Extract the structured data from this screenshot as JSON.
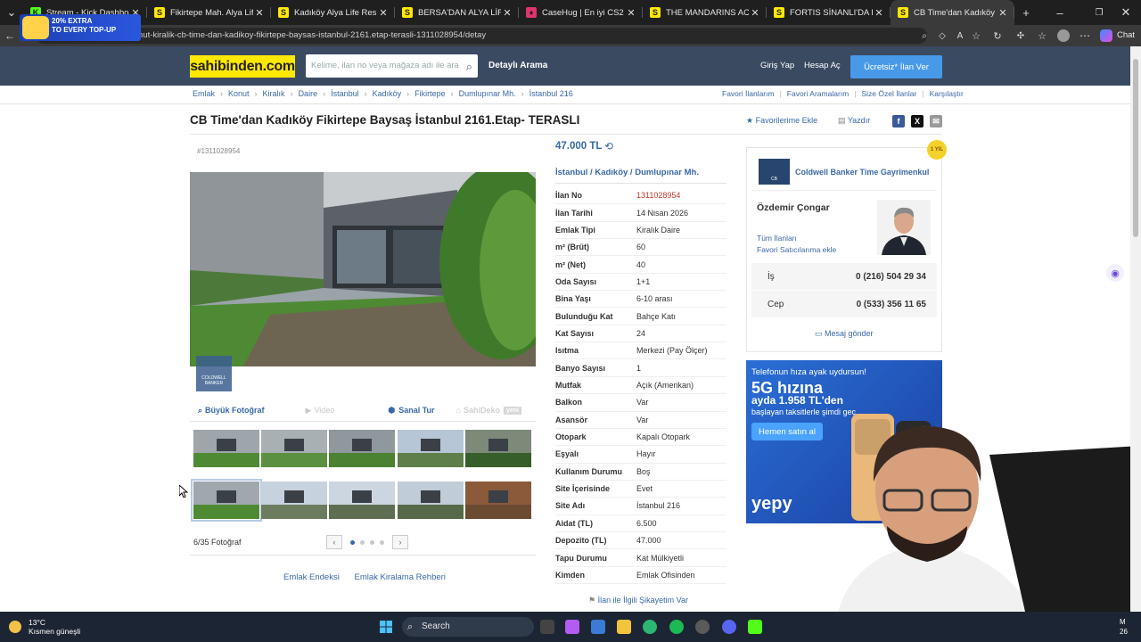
{
  "browser": {
    "tabs": [
      {
        "title": "Stream - Kick Dashboard",
        "icon": "kick-icon",
        "color": "#53fc18",
        "letter": "K"
      },
      {
        "title": "Fikirtepe Mah. Alya Life Resi",
        "icon": "sahibinden-icon",
        "color": "#ffe800",
        "letter": "S"
      },
      {
        "title": "Kadıköy Alya Life Residence",
        "icon": "sahibinden-icon",
        "color": "#ffe800",
        "letter": "S"
      },
      {
        "title": "BERSA'DAN ALYA LİFE RESİD",
        "icon": "sahibinden-icon",
        "color": "#ffe800",
        "letter": "S"
      },
      {
        "title": "CaseHug | En iyi CS2 (CS:GO",
        "icon": "casehug-icon",
        "color": "#e0336f",
        "letter": "♦"
      },
      {
        "title": "THE MANDARINS ACIBADEM",
        "icon": "sahibinden-icon",
        "color": "#ffe800",
        "letter": "S"
      },
      {
        "title": "FORTIS SİNANLI'DA KİRALIK",
        "icon": "sahibinden-icon",
        "color": "#ffe800",
        "letter": "S"
      },
      {
        "title": "CB Time'dan Kadıköy Fikirte",
        "icon": "sahibinden-icon",
        "color": "#ffe800",
        "letter": "S",
        "active": true
      }
    ],
    "url": "https://www.sahibinden.com/ilan/emlak-konut-kiralik-cb-time-dan-kadikoy-fikirtepe-baysas-istanbul-2161.etap-terasli-1311028954/detay",
    "url_display": "hen.com/ilan/emlak-konut-kiralik-cb-time-dan-kadikoy-fikirtepe-baysas-istanbul-2161.etap-terasli-1311028954/detay",
    "chat_label": "Chat",
    "promo": {
      "line1": "20% EXTRA",
      "line2": "TO EVERY TOP-UP"
    }
  },
  "header": {
    "logo": "sahibinden.com",
    "search_placeholder": "Kelime, ilan no veya mağaza adı ile ara",
    "advanced_search": "Detaylı Arama",
    "login": "Giriş Yap",
    "register": "Hesap Aç",
    "post_ad": "Ücretsiz* İlan Ver"
  },
  "breadcrumb": [
    "Emlak",
    "Konut",
    "Kiralık",
    "Daire",
    "İstanbul",
    "Kadıköy",
    "Fikirtepe",
    "Dumlupınar Mh.",
    "İstanbul 216"
  ],
  "right_links": [
    "Favori İlanlarım",
    "Favori Aramalarım",
    "Size Özel İlanlar",
    "Karşılaştır"
  ],
  "listing": {
    "title": "CB Time'dan Kadıköy Fikirtepe Baysaş İstanbul 2161.Etap- TERASLI",
    "add_favorite": "Favorilerime Ekle",
    "print": "Yazdır",
    "id_small": "#1311028954",
    "price": "47.000 TL",
    "location": "İstanbul  /  Kadıköy  /  Dumlupınar Mh.",
    "details": [
      {
        "key": "İlan No",
        "value": "1311028954",
        "highlight": true
      },
      {
        "key": "İlan Tarihi",
        "value": "14 Nisan 2026"
      },
      {
        "key": "Emlak Tipi",
        "value": "Kiralık Daire"
      },
      {
        "key": "m² (Brüt)",
        "value": "60"
      },
      {
        "key": "m² (Net)",
        "value": "40"
      },
      {
        "key": "Oda Sayısı",
        "value": "1+1"
      },
      {
        "key": "Bina Yaşı",
        "value": "6-10 arası"
      },
      {
        "key": "Bulunduğu Kat",
        "value": "Bahçe Katı"
      },
      {
        "key": "Kat Sayısı",
        "value": "24"
      },
      {
        "key": "Isıtma",
        "value": "Merkezi (Pay Ölçer)"
      },
      {
        "key": "Banyo Sayısı",
        "value": "1"
      },
      {
        "key": "Mutfak",
        "value": "Açık (Amerikan)"
      },
      {
        "key": "Balkon",
        "value": "Var"
      },
      {
        "key": "Asansör",
        "value": "Var"
      },
      {
        "key": "Otopark",
        "value": "Kapalı Otopark"
      },
      {
        "key": "Eşyalı",
        "value": "Hayır"
      },
      {
        "key": "Kullanım Durumu",
        "value": "Boş"
      },
      {
        "key": "Site İçerisinde",
        "value": "Evet"
      },
      {
        "key": "Site Adı",
        "value": "İstanbul 216"
      },
      {
        "key": "Aidat (TL)",
        "value": "6.500"
      },
      {
        "key": "Depozito (TL)",
        "value": "47.000"
      },
      {
        "key": "Tapu Durumu",
        "value": "Kat Mülkiyetli"
      },
      {
        "key": "Kimden",
        "value": "Emlak Ofisinden"
      }
    ],
    "complaint": "İlan ile İlgili Şikayetim Var"
  },
  "photos": {
    "tools": {
      "big_photo": "Büyük Fotoğraf",
      "video": "Video",
      "virtual_tour": "Sanal Tur",
      "sahideko": "SahiDeko",
      "new_badge": "yeni"
    },
    "counter": "6/35 Fotoğraf",
    "watermark": "COLDWELL BANKER",
    "current_page": 1,
    "page_count": 4
  },
  "bottom_links": [
    "Emlak Endeksi",
    "Emlak Kiralama Rehberi"
  ],
  "agent": {
    "office": "Coldwell Banker Time Gayrimenkul",
    "name": "Özdemir Çongar",
    "all_ads": "Tüm İlanları",
    "favorite_seller": "Favori Satıcılarıma ekle",
    "phones": [
      {
        "label": "İş",
        "number": "0 (216) 504 29 34"
      },
      {
        "label": "Cep",
        "number": "0 (533) 356 11 65"
      }
    ],
    "send_message": "Mesaj gönder",
    "badge": "1 YIL"
  },
  "ad": {
    "line1": "Telefonun hıza ayak uydursun!",
    "line2": "5G hızına",
    "line3": "ayda 1.958 TL'den",
    "line4": "başlayan taksitlerle şimdi geç.",
    "cta": "Hemen satın al",
    "brand": "yepy"
  },
  "taskbar": {
    "temp": "13°C",
    "weather": "Kısmen güneşli",
    "search": "Search",
    "time": "M",
    "date": "26"
  },
  "colors": {
    "link": "#3a68a6",
    "header_bg": "#3a4a61",
    "logo_bg": "#ffe800",
    "cta_blue": "#489ae9"
  }
}
